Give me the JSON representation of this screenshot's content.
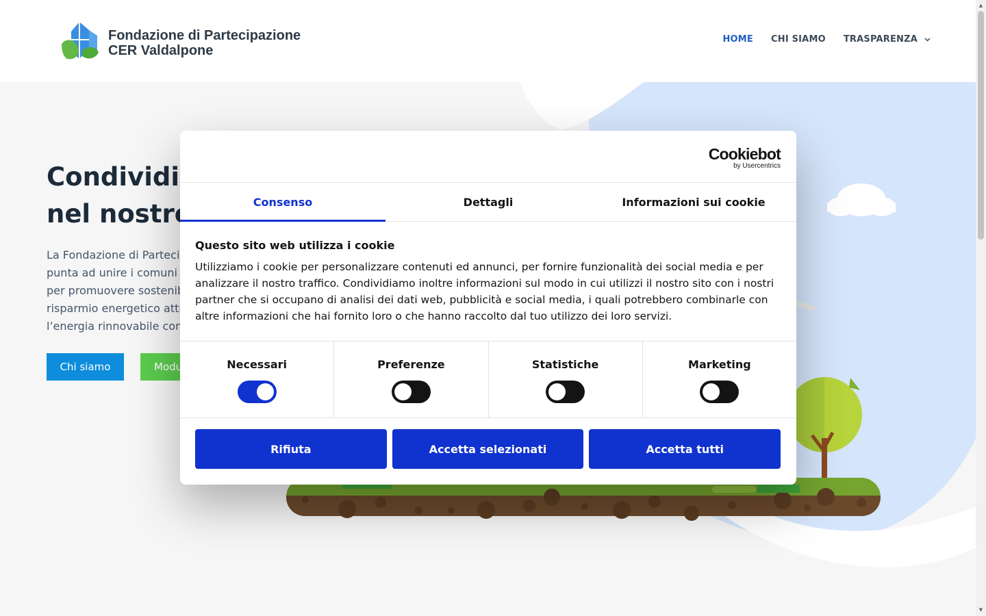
{
  "header": {
    "logo_line1": "Fondazione di Partecipazione",
    "logo_line2": "CER Valdalpone",
    "nav": [
      {
        "label": "HOME"
      },
      {
        "label": "CHI SIAMO"
      },
      {
        "label": "TRASPARENZA"
      }
    ]
  },
  "hero": {
    "title_line1": "Condividia",
    "title_line2": "nel nostro",
    "text_lines": [
      "La Fondazione di Parteci",
      "punta ad unire i comuni",
      "per promuovere sostenib",
      "risparmio energetico attr",
      "l’energia rinnovabile con"
    ],
    "btn_chi": "Chi siamo",
    "btn_mod": "Modu"
  },
  "cookie_dialog": {
    "brand": "Cookiebot",
    "brand_sub": "by Usercentrics",
    "tabs": [
      "Consenso",
      "Dettagli",
      "Informazioni sui cookie"
    ],
    "heading": "Questo sito web utilizza i cookie",
    "text": "Utilizziamo i cookie per personalizzare contenuti ed annunci, per fornire funzionalità dei social media e per analizzare il nostro traffico. Condividiamo inoltre informazioni sul modo in cui utilizzi il nostro sito con i nostri partner che si occupano di analisi dei dati web, pubblicità e social media, i quali potrebbero combinarle con altre informazioni che hai fornito loro o che hanno raccolto dal tuo utilizzo dei loro servizi.",
    "categories": [
      {
        "label": "Necessari",
        "on": true
      },
      {
        "label": "Preferenze",
        "on": false
      },
      {
        "label": "Statistiche",
        "on": false
      },
      {
        "label": "Marketing",
        "on": false
      }
    ],
    "buttons": [
      "Rifiuta",
      "Accetta selezionati",
      "Accetta tutti"
    ]
  },
  "colors": {
    "accent": "#1032cf",
    "nav_active": "#1f5fbf",
    "btn_chi": "#0d8ddb",
    "btn_mod": "#5bcb4e"
  }
}
